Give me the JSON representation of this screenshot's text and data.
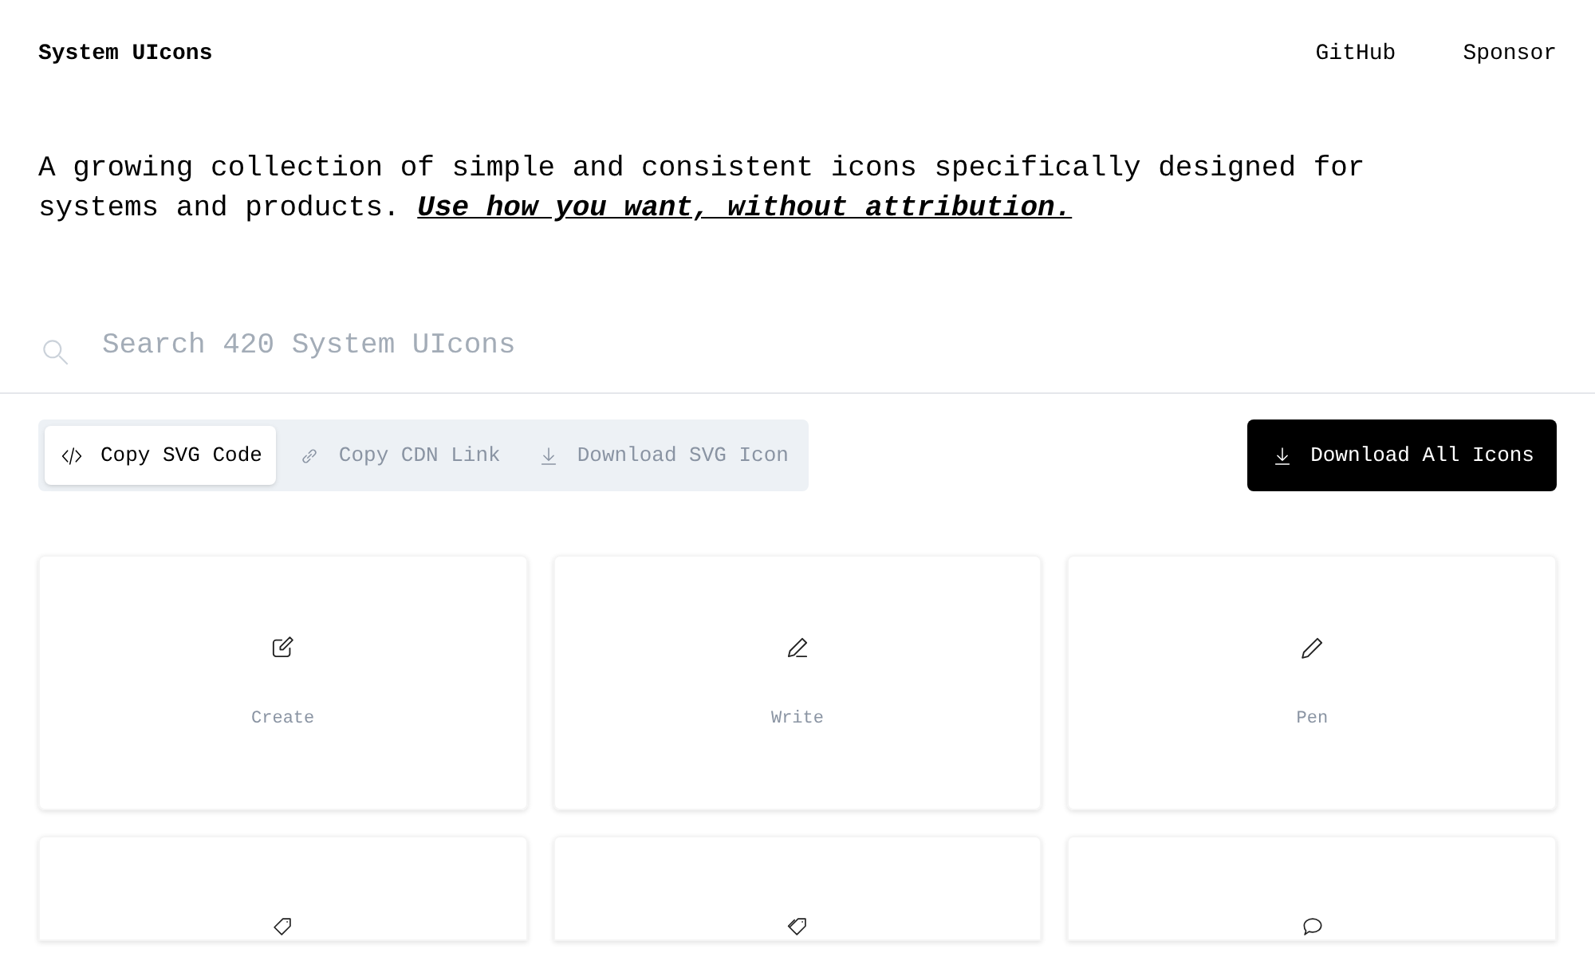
{
  "header": {
    "brand": "System UIcons",
    "links": [
      "GitHub",
      "Sponsor"
    ]
  },
  "intro": {
    "text": "A growing collection of simple and consistent icons specifically designed for systems and products. ",
    "link": "Use how you want, without attribution."
  },
  "search": {
    "placeholder": "Search 420 System UIcons"
  },
  "modes": [
    {
      "label": "Copy SVG Code",
      "selected": true
    },
    {
      "label": "Copy CDN Link",
      "selected": false
    },
    {
      "label": "Download SVG Icon",
      "selected": false
    }
  ],
  "download_all": "Download All Icons",
  "icons": [
    {
      "label": "Create",
      "cut_off": false
    },
    {
      "label": "Write",
      "cut_off": false
    },
    {
      "label": "Pen",
      "cut_off": false
    },
    {
      "cut_off": true
    },
    {
      "cut_off": true
    },
    {
      "cut_off": true
    }
  ]
}
